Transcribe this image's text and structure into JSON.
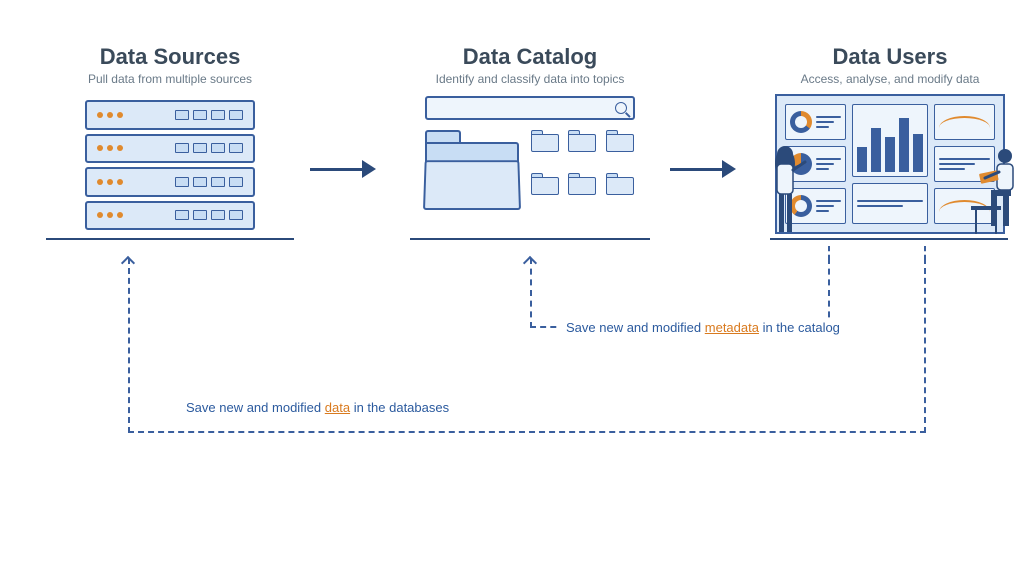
{
  "diagram": {
    "nodes": {
      "sources": {
        "title": "Data Sources",
        "subtitle": "Pull data from multiple sources"
      },
      "catalog": {
        "title": "Data Catalog",
        "subtitle": "Identify and classify data into topics"
      },
      "users": {
        "title": "Data Users",
        "subtitle": "Access, analyse, and modify data"
      }
    },
    "feedback": {
      "to_catalog": {
        "prefix": "Save new and modified ",
        "keyword": "metadata",
        "suffix": " in the catalog"
      },
      "to_sources": {
        "prefix": "Save new and modified ",
        "keyword": "data",
        "suffix": " in the databases"
      }
    },
    "flow": [
      "sources",
      "catalog",
      "users"
    ]
  },
  "palette": {
    "stroke": "#3a5f9e",
    "fill_light": "#dce9f8",
    "fill_lighter": "#eef5fc",
    "accent": "#e08a2e",
    "text_heading": "#3a4a5a",
    "text_sub": "#6a7a88",
    "text_link": "#2b5a9e"
  }
}
